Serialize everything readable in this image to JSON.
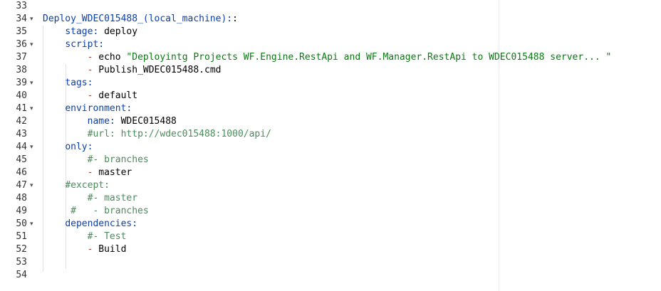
{
  "editor": {
    "lines": [
      {
        "n": "33",
        "fold": false,
        "indent": "",
        "tokens": []
      },
      {
        "n": "34",
        "fold": true,
        "indent": "",
        "tokens": [
          {
            "t": "key",
            "v": "Deploy_WDEC015488_(local_machine):"
          },
          {
            "t": "plain",
            "v": ":"
          }
        ]
      },
      {
        "n": "35",
        "fold": false,
        "indent": "    ",
        "tokens": [
          {
            "t": "key",
            "v": "stage:"
          },
          {
            "t": "plain",
            "v": " deploy"
          }
        ]
      },
      {
        "n": "36",
        "fold": true,
        "indent": "    ",
        "tokens": [
          {
            "t": "key",
            "v": "script:"
          }
        ]
      },
      {
        "n": "37",
        "fold": false,
        "indent": "        ",
        "tokens": [
          {
            "t": "dash",
            "v": "-"
          },
          {
            "t": "plain",
            "v": " echo "
          },
          {
            "t": "str",
            "v": "\"Deployintg Projects WF.Engine.RestApi and WF.Manager.RestApi to WDEC015488 server... \""
          }
        ]
      },
      {
        "n": "38",
        "fold": false,
        "indent": "        ",
        "tokens": [
          {
            "t": "dash",
            "v": "-"
          },
          {
            "t": "plain",
            "v": " Publish_WDEC015488.cmd"
          }
        ]
      },
      {
        "n": "39",
        "fold": true,
        "indent": "    ",
        "tokens": [
          {
            "t": "key",
            "v": "tags:"
          }
        ]
      },
      {
        "n": "40",
        "fold": false,
        "indent": "        ",
        "tokens": [
          {
            "t": "dash",
            "v": "-"
          },
          {
            "t": "plain",
            "v": " default"
          }
        ]
      },
      {
        "n": "41",
        "fold": true,
        "indent": "    ",
        "tokens": [
          {
            "t": "key",
            "v": "environment:"
          }
        ]
      },
      {
        "n": "42",
        "fold": false,
        "indent": "        ",
        "tokens": [
          {
            "t": "key",
            "v": "name:"
          },
          {
            "t": "plain",
            "v": " WDEC015488"
          }
        ]
      },
      {
        "n": "43",
        "fold": false,
        "indent": "        ",
        "tokens": [
          {
            "t": "com",
            "v": "#url: http://wdec015488:1000/api/"
          }
        ]
      },
      {
        "n": "44",
        "fold": true,
        "indent": "    ",
        "tokens": [
          {
            "t": "key",
            "v": "only:"
          }
        ]
      },
      {
        "n": "45",
        "fold": false,
        "indent": "        ",
        "tokens": [
          {
            "t": "com",
            "v": "#- branches"
          }
        ]
      },
      {
        "n": "46",
        "fold": false,
        "indent": "        ",
        "tokens": [
          {
            "t": "dash",
            "v": "-"
          },
          {
            "t": "plain",
            "v": " master"
          }
        ]
      },
      {
        "n": "47",
        "fold": true,
        "indent": "    ",
        "tokens": [
          {
            "t": "com",
            "v": "#except:"
          }
        ]
      },
      {
        "n": "48",
        "fold": false,
        "indent": "        ",
        "tokens": [
          {
            "t": "com",
            "v": "#- master"
          }
        ]
      },
      {
        "n": "49",
        "fold": false,
        "indent": "     ",
        "tokens": [
          {
            "t": "com",
            "v": "#   - branches"
          }
        ]
      },
      {
        "n": "50",
        "fold": true,
        "indent": "    ",
        "tokens": [
          {
            "t": "key",
            "v": "dependencies:"
          }
        ]
      },
      {
        "n": "51",
        "fold": false,
        "indent": "        ",
        "tokens": [
          {
            "t": "com",
            "v": "#- Test"
          }
        ]
      },
      {
        "n": "52",
        "fold": false,
        "indent": "        ",
        "tokens": [
          {
            "t": "dash",
            "v": "-"
          },
          {
            "t": "plain",
            "v": " Build"
          }
        ]
      },
      {
        "n": "53",
        "fold": false,
        "indent": "",
        "tokens": []
      },
      {
        "n": "54",
        "fold": false,
        "indent": "",
        "tokens": []
      }
    ],
    "fold_glyph": "▾"
  }
}
